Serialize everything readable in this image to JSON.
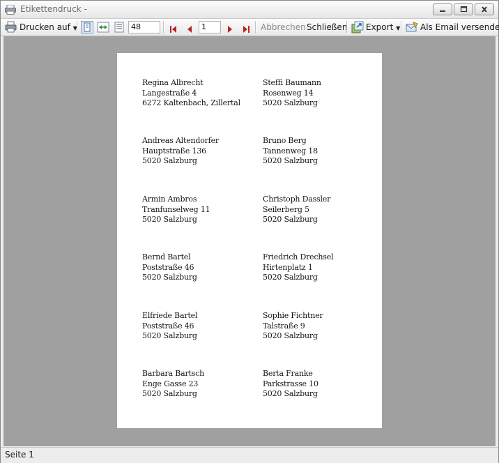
{
  "window": {
    "title": "Etikettendruck -"
  },
  "toolbar": {
    "print_label": "Drucken auf",
    "zoom_value": "48",
    "page_value": "1",
    "cancel_label": "Abbrechen",
    "close_label": "Schließen",
    "export_label": "Export",
    "email_label": "Als Email versenden"
  },
  "labels": [
    {
      "name": "Regina Albrecht",
      "street": "Langestraße 4",
      "city": "6272 Kaltenbach, Zillertal"
    },
    {
      "name": "Steffi Baumann",
      "street": "Rosenweg 14",
      "city": "5020 Salzburg"
    },
    {
      "name": "Andreas Altendorfer",
      "street": "Hauptstraße 136",
      "city": "5020 Salzburg"
    },
    {
      "name": "Bruno Berg",
      "street": "Tannenweg 18",
      "city": "5020 Salzburg"
    },
    {
      "name": "Armin Ambros",
      "street": "Tranfunselweg 11",
      "city": "5020 Salzburg"
    },
    {
      "name": "Christoph Dassler",
      "street": "Seilerberg 5",
      "city": "5020 Salzburg"
    },
    {
      "name": "Bernd Bartel",
      "street": "Poststraße 46",
      "city": "5020 Salzburg"
    },
    {
      "name": "Friedrich Drechsel",
      "street": "Hirtenplatz 1",
      "city": "5020 Salzburg"
    },
    {
      "name": "Elfriede Bartel",
      "street": "Poststraße 46",
      "city": "5020 Salzburg"
    },
    {
      "name": "Sophie Fichtner",
      "street": "Talstraße 9",
      "city": "5020 Salzburg"
    },
    {
      "name": "Barbara Bartsch",
      "street": "Enge Gasse 23",
      "city": "5020 Salzburg"
    },
    {
      "name": "Berta Franke",
      "street": "Parkstrasse 10",
      "city": "5020 Salzburg"
    }
  ],
  "status": {
    "page_text": "Seite 1"
  }
}
